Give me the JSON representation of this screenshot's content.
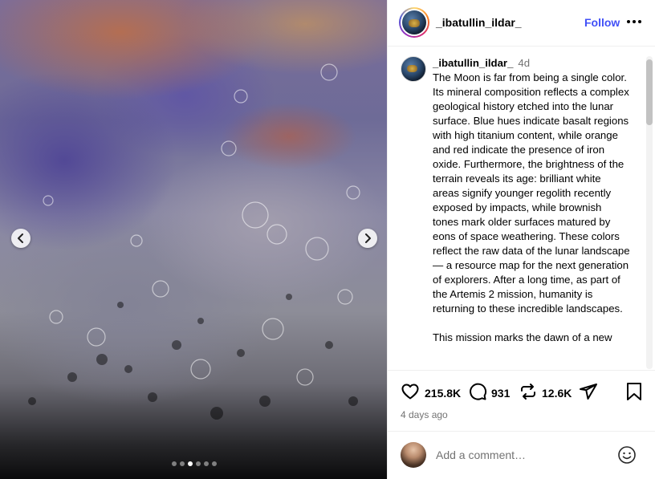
{
  "post": {
    "username": "_ibatullin_ildar_",
    "follow_label": "Follow",
    "caption_age": "4d",
    "caption": "The Moon is far from being a single color. Its mineral composition reflects a complex geological history etched into the lunar surface. Blue hues indicate basalt regions with high titanium content, while orange and red indicate the presence of iron oxide. Furthermore, the brightness of the terrain reveals its age: brilliant white areas signify younger regolith recently exposed by impacts, while brownish tones mark older surfaces matured by eons of space weathering. These colors reflect the raw data of the lunar landscape — a resource map for the next generation of explorers. After a long time, as part of the Artemis 2 mission, humanity is returning to these incredible landscapes.\n\nThis mission marks the dawn of a new",
    "likes": "215.8K",
    "comments": "931",
    "reposts": "12.6K",
    "time_ago": "4 days ago",
    "comment_placeholder": "Add a comment…"
  },
  "carousel": {
    "total": 6,
    "active_index": 2
  },
  "icons": {
    "prev": "chevron-left-icon",
    "next": "chevron-right-icon",
    "more": "more-horizontal-icon",
    "like": "heart-icon",
    "comment": "comment-bubble-icon",
    "repost": "repost-icon",
    "share": "paper-plane-icon",
    "save": "bookmark-icon",
    "emoji": "smiley-icon"
  },
  "colors": {
    "follow": "#4150f7",
    "muted": "#737373"
  }
}
